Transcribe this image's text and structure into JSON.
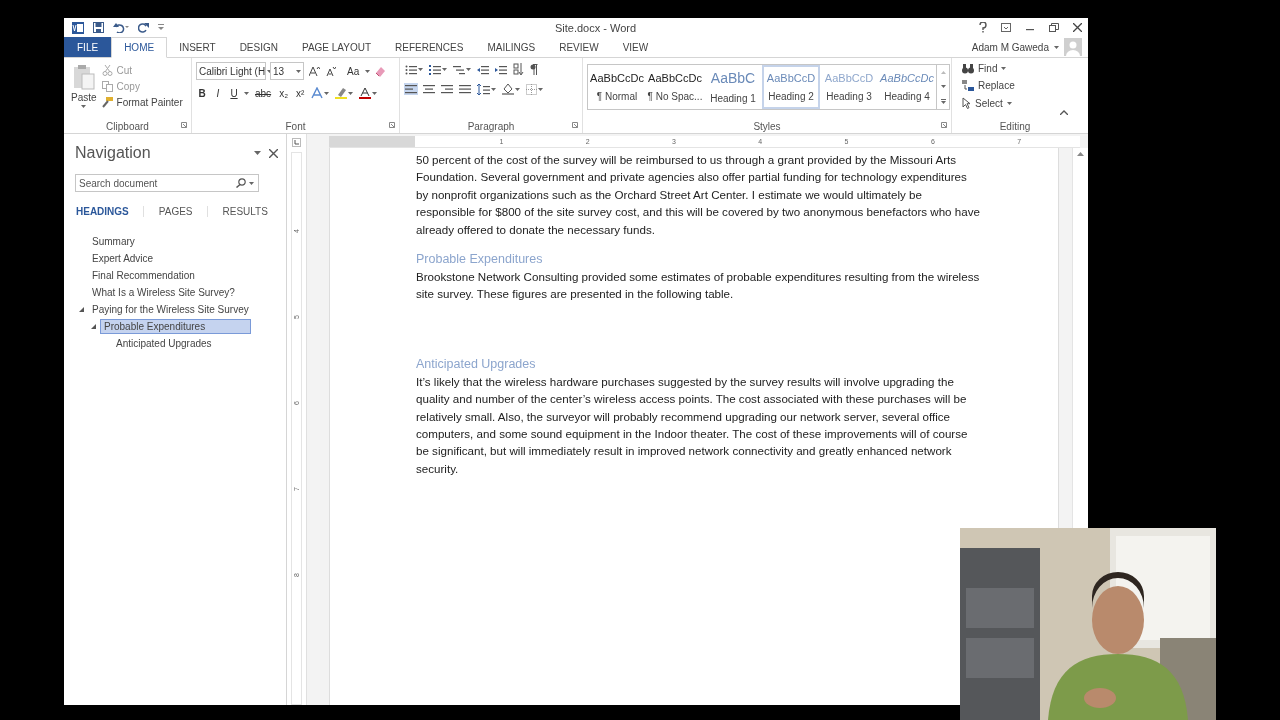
{
  "window": {
    "title": "Site.docx - Word",
    "user": "Adam M Gaweda"
  },
  "ribbon_tabs": [
    {
      "label": "FILE",
      "kind": "file",
      "selected": false
    },
    {
      "label": "HOME",
      "kind": "tab",
      "selected": true
    },
    {
      "label": "INSERT",
      "kind": "tab",
      "selected": false
    },
    {
      "label": "DESIGN",
      "kind": "tab",
      "selected": false
    },
    {
      "label": "PAGE LAYOUT",
      "kind": "tab",
      "selected": false
    },
    {
      "label": "REFERENCES",
      "kind": "tab",
      "selected": false
    },
    {
      "label": "MAILINGS",
      "kind": "tab",
      "selected": false
    },
    {
      "label": "REVIEW",
      "kind": "tab",
      "selected": false
    },
    {
      "label": "VIEW",
      "kind": "tab",
      "selected": false
    }
  ],
  "ribbon": {
    "clipboard": {
      "label": "Clipboard",
      "paste": "Paste",
      "cut": "Cut",
      "copy": "Copy",
      "format_painter": "Format Painter"
    },
    "font": {
      "label": "Font",
      "font_name": "Calibri Light (H",
      "font_size": "13",
      "case_button": "Aa",
      "format_buttons": [
        "B",
        "I",
        "U",
        "abc",
        "x₂",
        "x²"
      ]
    },
    "paragraph": {
      "label": "Paragraph",
      "align_buttons": [
        {
          "kind": "left",
          "selected": true
        },
        {
          "kind": "center",
          "selected": false
        },
        {
          "kind": "right",
          "selected": false
        },
        {
          "kind": "justify",
          "selected": false
        }
      ]
    },
    "styles": {
      "label": "Styles",
      "items": [
        {
          "kind": "normal",
          "preview": "AaBbCcDc",
          "name": "¶ Normal",
          "selected": false
        },
        {
          "kind": "normal",
          "preview": "AaBbCcDc",
          "name": "¶ No Spac...",
          "selected": false
        },
        {
          "kind": "heading1",
          "preview": "AaBbC",
          "name": "Heading 1",
          "selected": false
        },
        {
          "kind": "heading2",
          "preview": "AaBbCcD",
          "name": "Heading 2",
          "selected": true
        },
        {
          "kind": "heading3",
          "preview": "AaBbCcD",
          "name": "Heading 3",
          "selected": false
        },
        {
          "kind": "heading4",
          "preview": "AaBbCcDc",
          "name": "Heading 4",
          "selected": false
        }
      ]
    },
    "editing": {
      "label": "Editing",
      "find": "Find",
      "replace": "Replace",
      "select": "Select"
    }
  },
  "navigation": {
    "title": "Navigation",
    "search_placeholder": "Search document",
    "tabs": [
      {
        "label": "HEADINGS",
        "selected": true
      },
      {
        "label": "PAGES",
        "selected": false
      },
      {
        "label": "RESULTS",
        "selected": false
      }
    ],
    "headings": [
      {
        "label": "Summary",
        "selected": false
      },
      {
        "label": "Expert Advice",
        "selected": false
      },
      {
        "label": "Final Recommendation",
        "selected": false
      },
      {
        "label": "What Is a Wireless Site Survey?",
        "selected": false
      },
      {
        "label": "Paying for the Wireless Site Survey",
        "selected": false,
        "expanded": true,
        "children": [
          {
            "label": "Probable Expenditures",
            "selected": true,
            "expanded": true,
            "children": [
              {
                "label": "Anticipated Upgrades",
                "selected": false
              }
            ]
          }
        ]
      }
    ]
  },
  "rulers": {
    "horizontal": [
      "1",
      "2",
      "3",
      "4",
      "5",
      "6",
      "7"
    ],
    "vertical": [
      "4",
      "5",
      "6",
      "7",
      "8"
    ]
  },
  "document": {
    "blocks": [
      {
        "kind": "paragraph",
        "text": "50 percent of the cost of the survey will be reimbursed to us through a grant provided by the Missouri Arts Foundation. Several government and private agencies also offer partial funding for technology expenditures by nonprofit organizations such as the Orchard Street Art Center. I estimate we would ultimately be responsible for $800 of the site survey cost, and this will be covered by two anonymous benefactors who have already offered to donate the necessary funds."
      },
      {
        "kind": "heading",
        "text": "Probable Expenditures"
      },
      {
        "kind": "paragraph",
        "text": "Brookstone Network Consulting provided some estimates of probable expenditures resulting from the wireless site survey. These figures are presented in the following table."
      },
      {
        "kind": "heading",
        "text": "Anticipated Upgrades"
      },
      {
        "kind": "paragraph",
        "text": "It’s likely that the wireless hardware purchases suggested by the survey results will involve upgrading the quality and number of the center’s wireless access points. The cost associated with these purchases will be relatively small. Also, the surveyor will probably recommend upgrading our network server, several office computers, and some sound equipment in the Indoor theater. The cost of these improvements will of course be significant, but will immediately result in improved network connectivity and greatly enhanced network security."
      }
    ]
  }
}
